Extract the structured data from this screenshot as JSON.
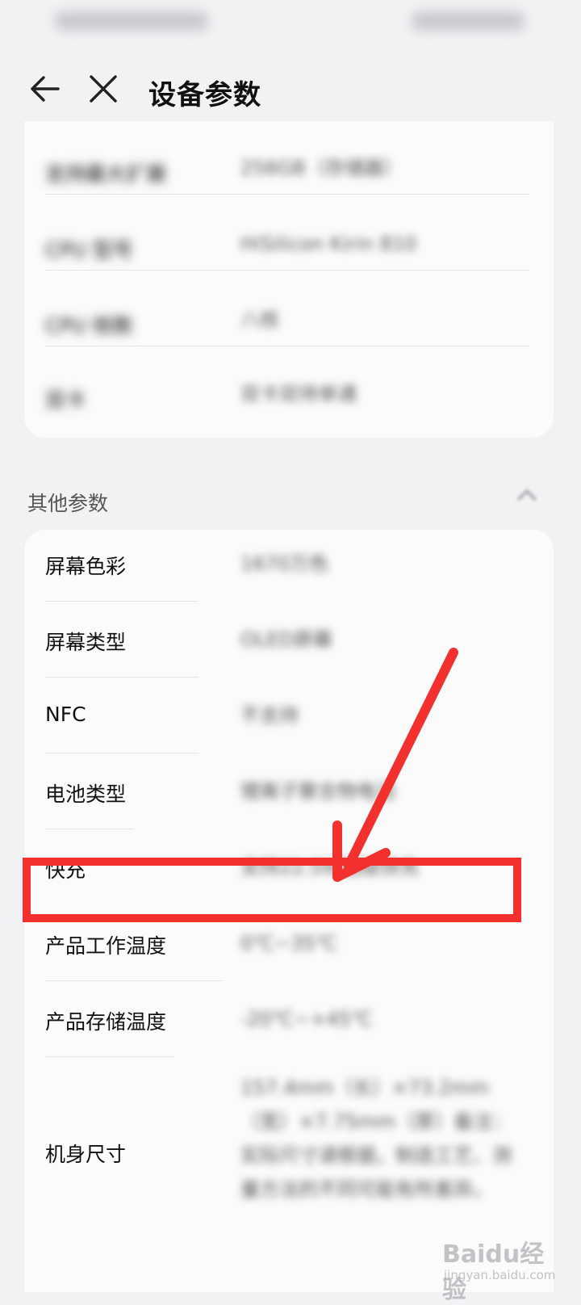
{
  "header": {
    "title": "设备参数"
  },
  "top_card": {
    "rows": [
      {
        "label": "支持最大扩展",
        "value": "256GB（存储器）"
      },
      {
        "label": "CPU 型号",
        "value": "HiSilicon Kirin 810"
      },
      {
        "label": "CPU 核数",
        "value": "八核"
      },
      {
        "label": "双卡",
        "value": "双卡双待单通"
      }
    ]
  },
  "other_section": {
    "title": "其他参数",
    "rows": [
      {
        "label": "屏幕色彩",
        "value": "1670万色"
      },
      {
        "label": "屏幕类型",
        "value": "OLED屏幕"
      },
      {
        "label": "NFC",
        "value": "不支持"
      },
      {
        "label": "电池类型",
        "value": "锂离子聚合物电池"
      },
      {
        "label": "快充",
        "value": "支持22.5W超级快充"
      },
      {
        "label": "产品工作温度",
        "value": "0℃~35℃"
      },
      {
        "label": "产品存储温度",
        "value": "-20℃~+45℃"
      },
      {
        "label": "机身尺寸",
        "value": "157.4mm（长）×73.2mm（宽）×7.75mm（厚）备注：实际尺寸请根据，制造工艺、测量方法的不同可能有所差异。"
      }
    ]
  },
  "watermark": {
    "brand": "Baidu经验",
    "domain": "jingyan.baidu.com"
  },
  "colors": {
    "highlight": "#f2302d",
    "background": "#f1f2f4",
    "card": "#fbfbfc"
  }
}
